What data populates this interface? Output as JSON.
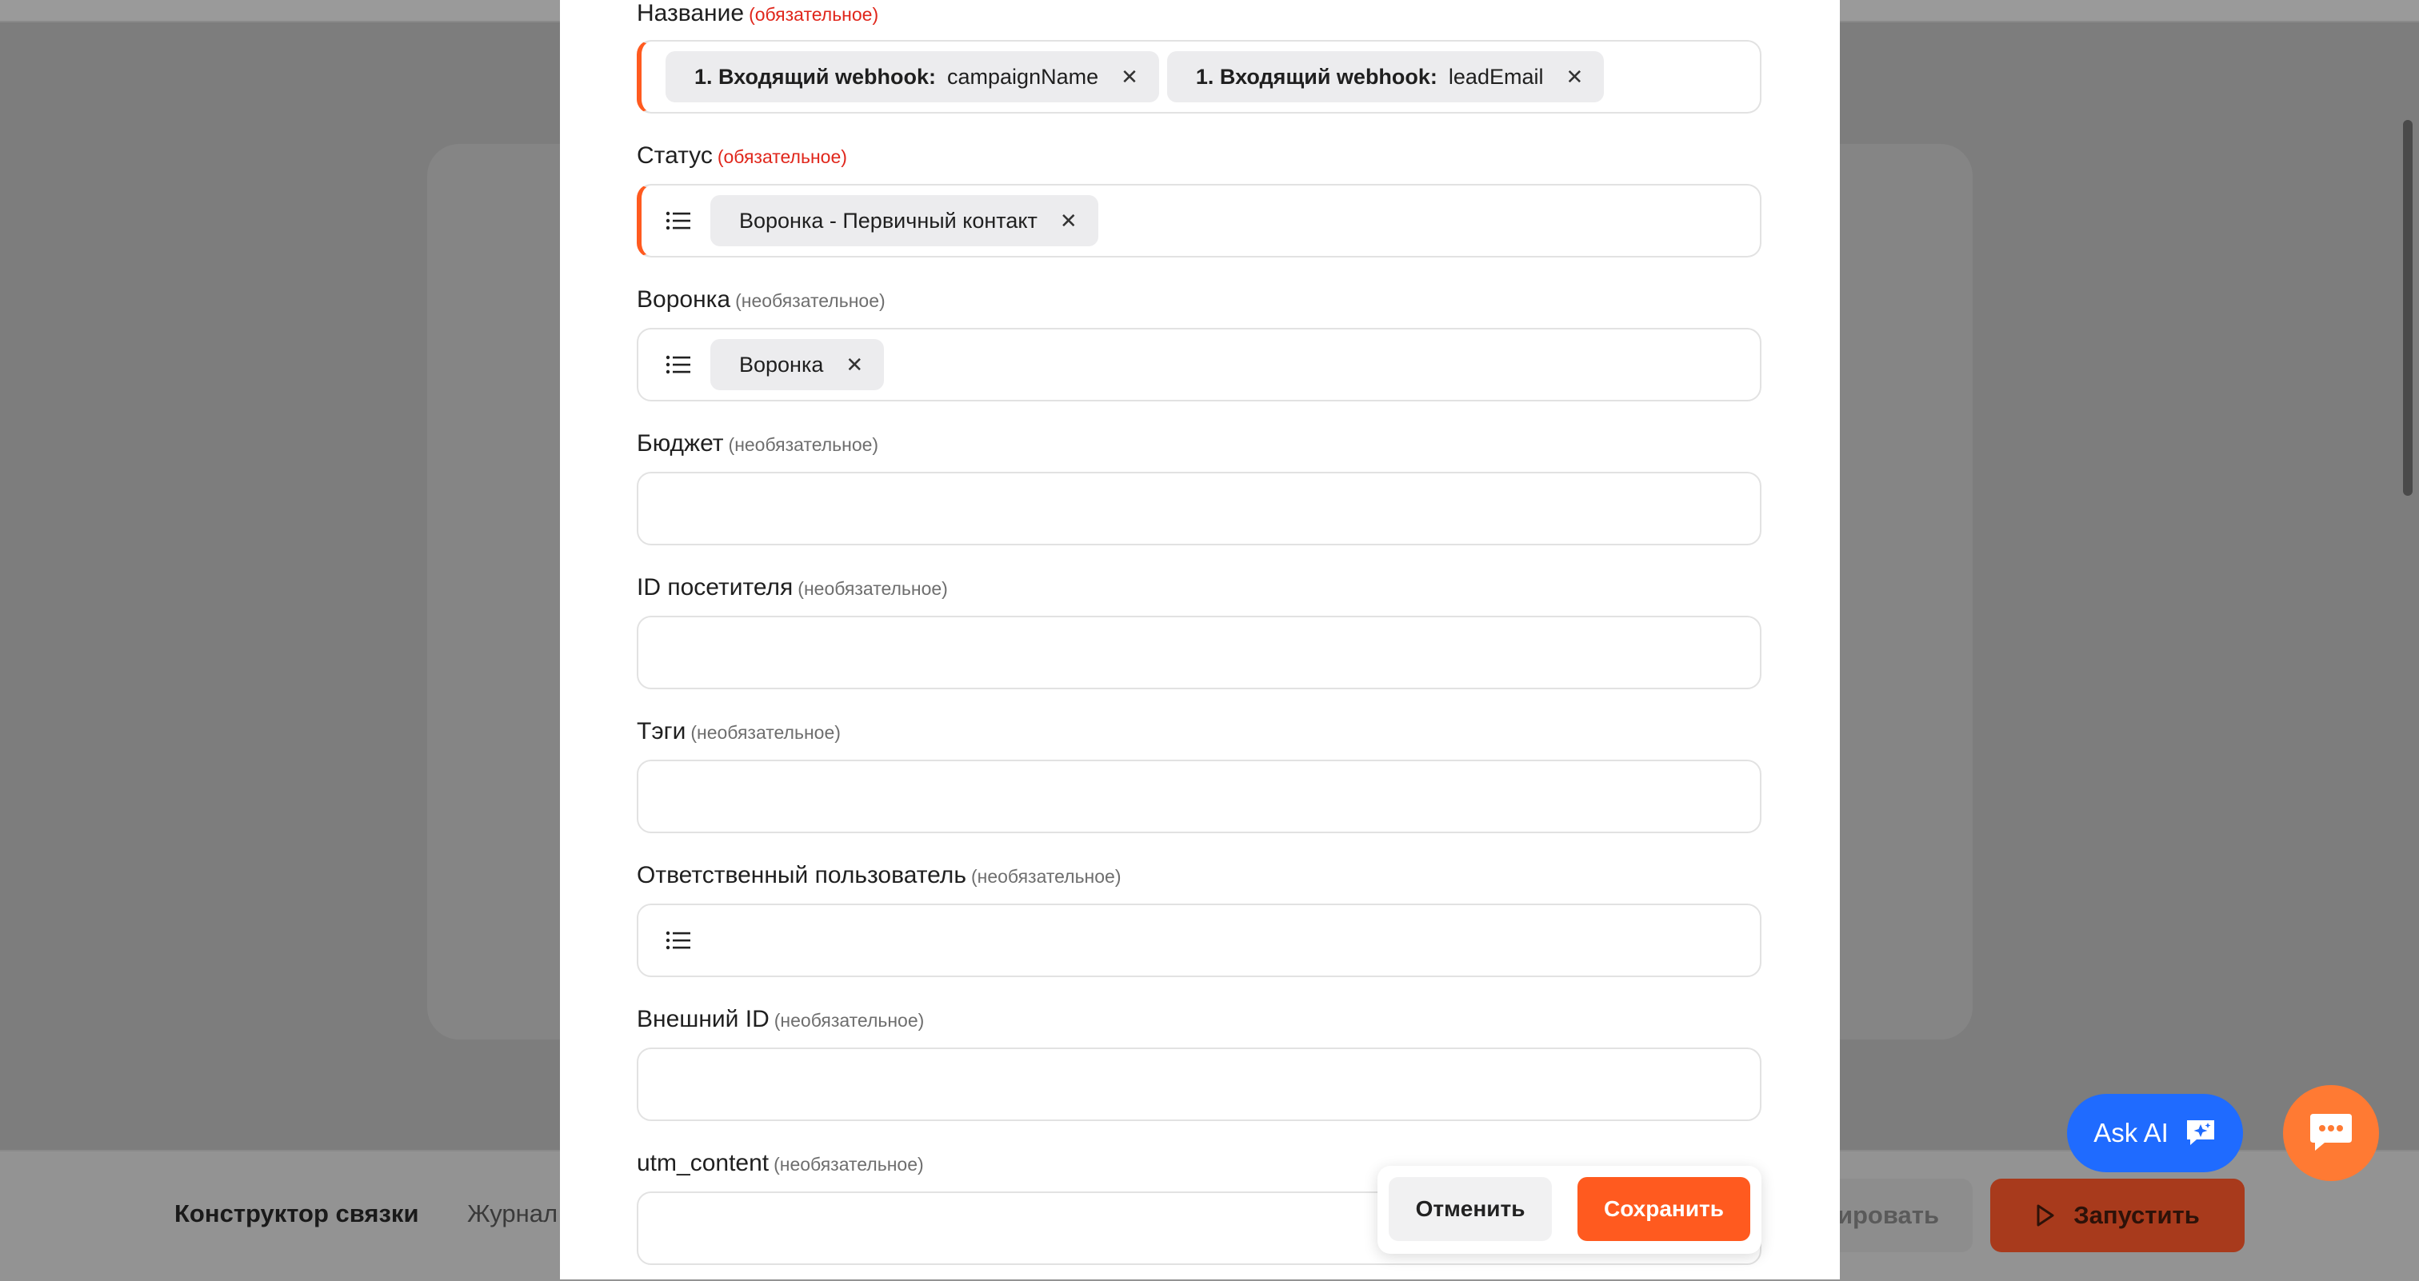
{
  "background": {
    "tabs": {
      "builder": "Конструктор связки",
      "journal": "Журнал"
    },
    "copy_button": "ировать",
    "run_button": "Запустить"
  },
  "form": {
    "fields": [
      {
        "label": "Название",
        "hint": "(обязательное)",
        "required": true,
        "chips": [
          {
            "source": "1. Входящий webhook:",
            "value": "campaignName"
          },
          {
            "source": "1. Входящий webhook:",
            "value": "leadEmail"
          }
        ]
      },
      {
        "label": "Статус",
        "hint": "(обязательное)",
        "required": true,
        "list_icon": true,
        "chips": [
          {
            "value": "Воронка - Первичный контакт"
          }
        ]
      },
      {
        "label": "Воронка",
        "hint": "(необязательное)",
        "list_icon": true,
        "chips": [
          {
            "value": "Воронка"
          }
        ]
      },
      {
        "label": "Бюджет",
        "hint": "(необязательное)"
      },
      {
        "label": "ID посетителя",
        "hint": "(необязательное)"
      },
      {
        "label": "Тэги",
        "hint": "(необязательное)"
      },
      {
        "label": "Ответственный пользователь",
        "hint": "(необязательное)",
        "list_icon": true
      },
      {
        "label": "Внешний ID",
        "hint": "(необязательное)"
      },
      {
        "label": "utm_content",
        "hint": "(необязательное)"
      }
    ],
    "remove_glyph": "✕"
  },
  "actions": {
    "cancel": "Отменить",
    "save": "Сохранить"
  },
  "floating": {
    "ask_ai": "Ask AI"
  },
  "colors": {
    "accent": "#ff5a1f",
    "required_hint": "#e0261b",
    "ask_ai": "#1f6bff",
    "chat": "#ff7a33"
  },
  "icons": [
    "list-icon",
    "close-icon",
    "play-icon",
    "ai-sparkle-icon",
    "chat-bubble-icon"
  ]
}
